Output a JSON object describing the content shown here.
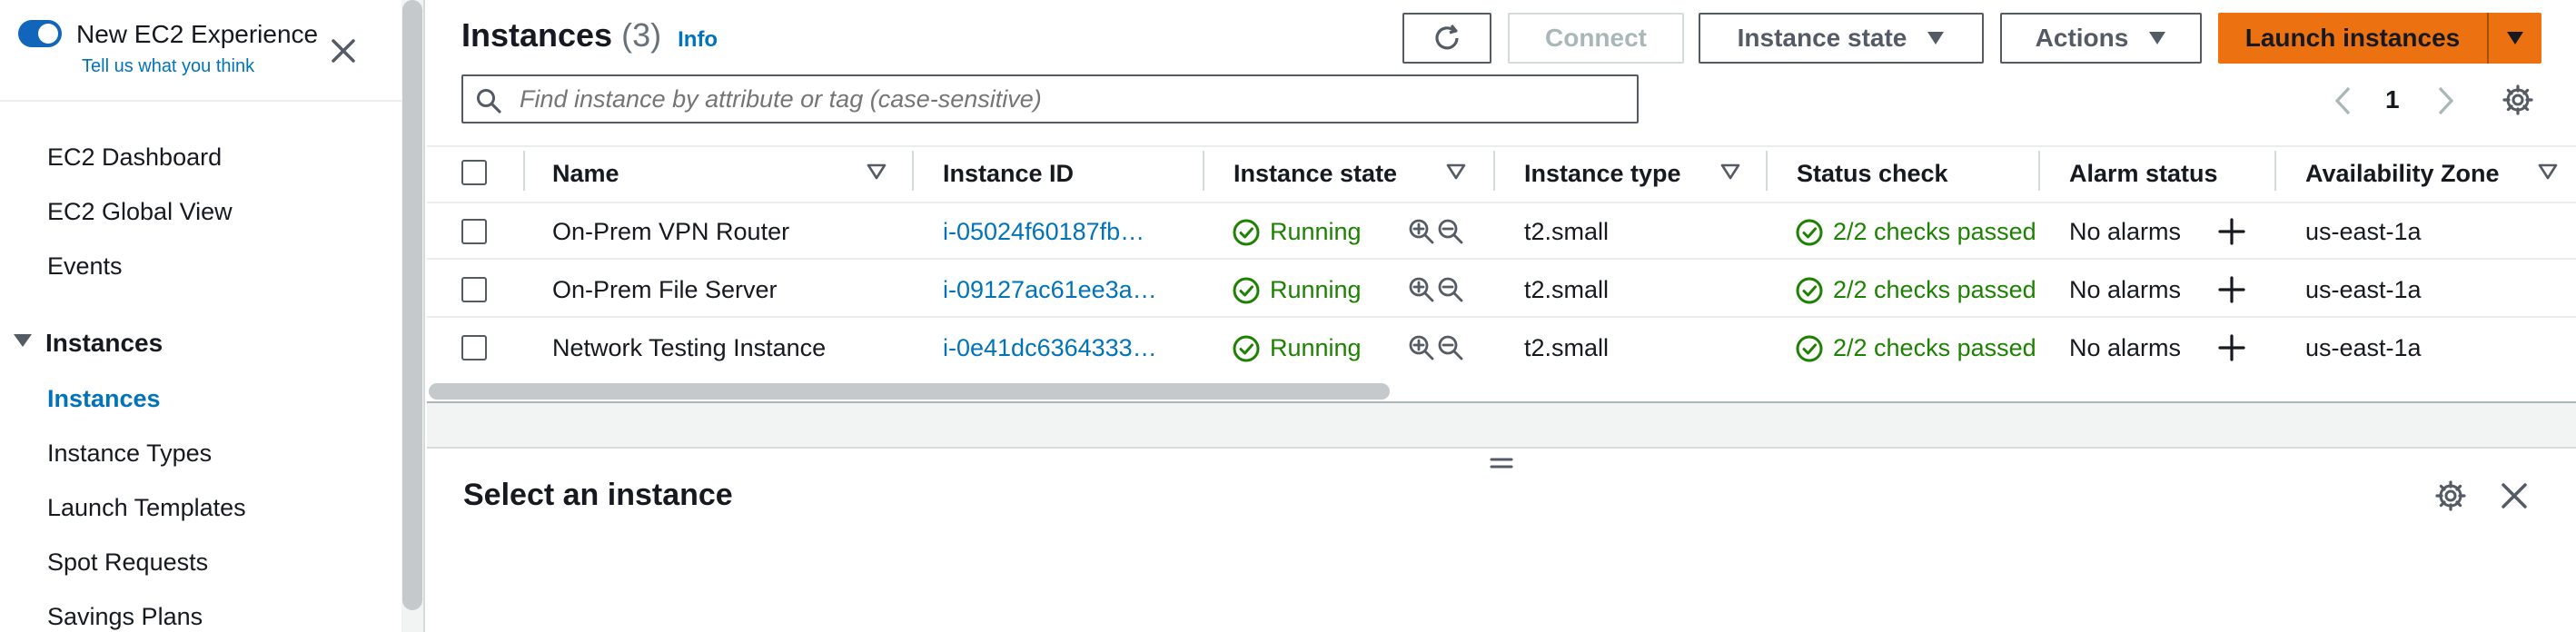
{
  "sidebar": {
    "toggle_label": "New EC2 Experience",
    "feedback_link": "Tell us what you think",
    "items": [
      {
        "label": "EC2 Dashboard"
      },
      {
        "label": "EC2 Global View"
      },
      {
        "label": "Events"
      }
    ],
    "section": {
      "label": "Instances"
    },
    "section_items": [
      {
        "label": "Instances",
        "active": true
      },
      {
        "label": "Instance Types"
      },
      {
        "label": "Launch Templates"
      },
      {
        "label": "Spot Requests"
      },
      {
        "label": "Savings Plans"
      }
    ]
  },
  "header": {
    "title": "Instances",
    "count": "(3)",
    "info": "Info",
    "connect": "Connect",
    "instance_state": "Instance state",
    "actions": "Actions",
    "launch": "Launch instances"
  },
  "search": {
    "placeholder": "Find instance by attribute or tag (case-sensitive)"
  },
  "pagination": {
    "page": "1"
  },
  "table": {
    "columns": [
      "Name",
      "Instance ID",
      "Instance state",
      "Instance type",
      "Status check",
      "Alarm status",
      "Availability Zone"
    ],
    "rows": [
      {
        "name": "On-Prem VPN Router",
        "id": "i-05024f60187fb…",
        "state": "Running",
        "type": "t2.small",
        "status": "2/2 checks passed",
        "alarm": "No alarms",
        "az": "us-east-1a"
      },
      {
        "name": "On-Prem File Server",
        "id": "i-09127ac61ee3a…",
        "state": "Running",
        "type": "t2.small",
        "status": "2/2 checks passed",
        "alarm": "No alarms",
        "az": "us-east-1a"
      },
      {
        "name": "Network Testing Instance",
        "id": "i-0e41dc6364333…",
        "state": "Running",
        "type": "t2.small",
        "status": "2/2 checks passed",
        "alarm": "No alarms",
        "az": "us-east-1a"
      }
    ]
  },
  "details": {
    "title": "Select an instance"
  },
  "colors": {
    "primary": "#ec7211",
    "link": "#0073bb",
    "success": "#1d8102",
    "toggle": "#1166bb"
  }
}
